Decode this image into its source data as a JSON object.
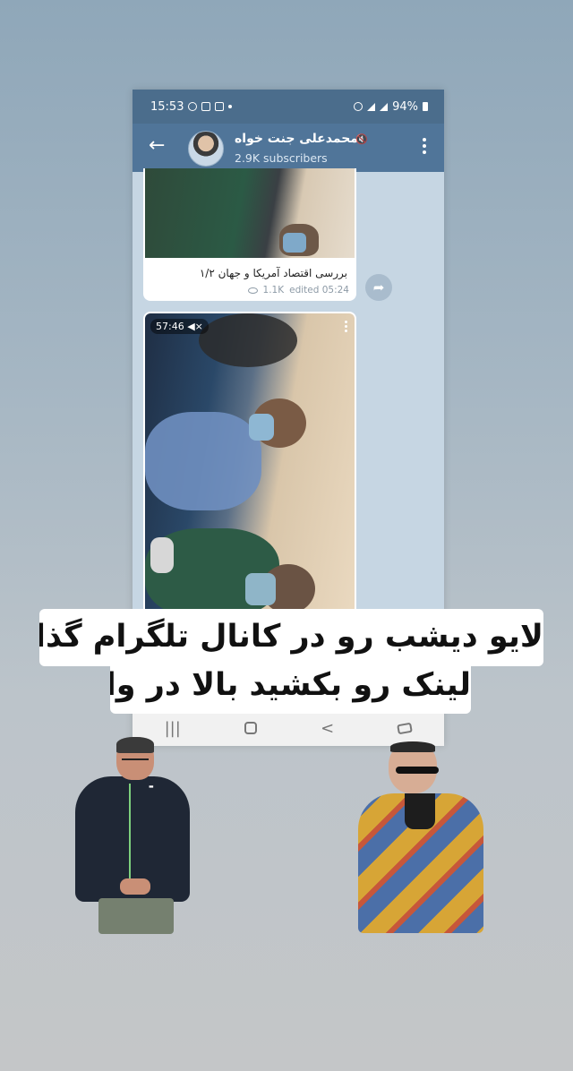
{
  "status_bar": {
    "time": "15:53",
    "battery": "94%"
  },
  "channel": {
    "title": "محمدعلی جنت خواه",
    "subscribers": "2.9K subscribers"
  },
  "messages": [
    {
      "caption": "بررسی اقتصاد آمریکا و جهان ۱/۲",
      "views": "1.1K",
      "edited": "edited 05:24"
    },
    {
      "video_duration": "57:46"
    }
  ],
  "icons": {
    "back": "←",
    "share": "➦",
    "mute": "🔇",
    "nav_recent": "|||",
    "nav_back": "<"
  },
  "overlay": {
    "line1": "لایو دیشب رو در کانال تلگرام گذاشتم",
    "line2": "لینک رو بکشید بالا در واقع"
  },
  "colors": {
    "header": "#507599",
    "status_bar": "#4b6d8c",
    "chat_bg": "#c6d6e3"
  }
}
